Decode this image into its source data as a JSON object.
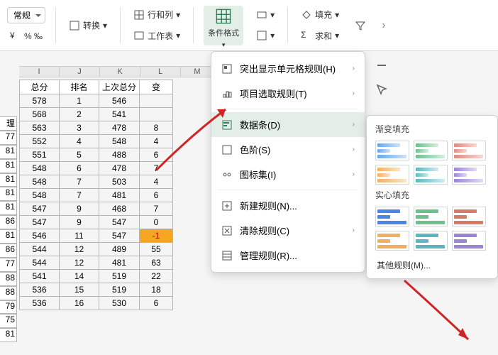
{
  "toolbar": {
    "style_select": "常规",
    "convert": "转换",
    "rows_cols": "行和列",
    "worksheet": "工作表",
    "cond_format": "条件格式",
    "fill": "填充",
    "sum": "求和"
  },
  "columns": [
    "I",
    "J",
    "K",
    "L",
    "M"
  ],
  "headers": {
    "c1": "总分",
    "c2": "排名",
    "c3": "上次总分",
    "c4": "变"
  },
  "row_labels": [
    "理",
    "77",
    "81",
    "81",
    "81",
    "81",
    "81",
    "86",
    "81",
    "86",
    "77",
    "88",
    "88",
    "79",
    "75",
    "81"
  ],
  "rows": [
    {
      "a": "578",
      "b": "1",
      "c": "546",
      "d": ""
    },
    {
      "a": "568",
      "b": "2",
      "c": "541",
      "d": ""
    },
    {
      "a": "563",
      "b": "3",
      "c": "478",
      "d": "8"
    },
    {
      "a": "552",
      "b": "4",
      "c": "548",
      "d": "4"
    },
    {
      "a": "551",
      "b": "5",
      "c": "488",
      "d": "6"
    },
    {
      "a": "548",
      "b": "6",
      "c": "478",
      "d": "7"
    },
    {
      "a": "548",
      "b": "7",
      "c": "503",
      "d": "4"
    },
    {
      "a": "548",
      "b": "7",
      "c": "481",
      "d": "6"
    },
    {
      "a": "547",
      "b": "9",
      "c": "468",
      "d": "7"
    },
    {
      "a": "547",
      "b": "9",
      "c": "547",
      "d": "0"
    },
    {
      "a": "546",
      "b": "11",
      "c": "547",
      "d": "-1",
      "hl": true
    },
    {
      "a": "544",
      "b": "12",
      "c": "489",
      "d": "55"
    },
    {
      "a": "544",
      "b": "12",
      "c": "481",
      "d": "63"
    },
    {
      "a": "541",
      "b": "14",
      "c": "519",
      "d": "22"
    },
    {
      "a": "536",
      "b": "15",
      "c": "519",
      "d": "18"
    },
    {
      "a": "536",
      "b": "16",
      "c": "530",
      "d": "6"
    }
  ],
  "menu": {
    "highlight": "突出显示单元格规则(H)",
    "top": "项目选取规则(T)",
    "databar": "数据条(D)",
    "colorscale": "色阶(S)",
    "iconset": "图标集(I)",
    "newrule": "新建规则(N)...",
    "clear": "清除规则(C)",
    "manage": "管理规则(R)..."
  },
  "sub": {
    "gradient": "渐变填充",
    "solid": "实心填充",
    "more": "其他规则(M)..."
  }
}
